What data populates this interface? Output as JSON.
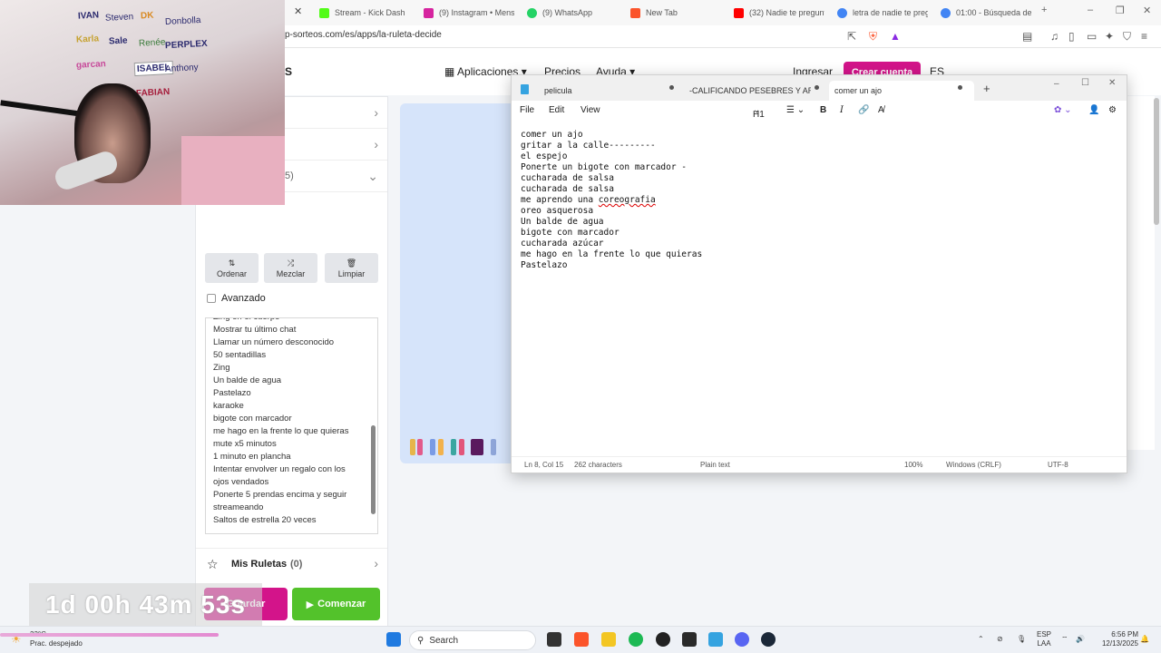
{
  "browser": {
    "tabs": [
      {
        "label": "Stream - Kick Dash",
        "color": "#53fc18"
      },
      {
        "label": "(9) Instagram • Mensa",
        "color": "#d6249f"
      },
      {
        "label": "(9) WhatsApp",
        "color": "#25d366"
      },
      {
        "label": "New Tab",
        "color": "#fb542b"
      },
      {
        "label": "(32) Nadie te pregunt",
        "color": "#ff0000"
      },
      {
        "label": "letra de nadie te preg",
        "color": "#4285f4"
      },
      {
        "label": "01:00 - Búsqueda de G",
        "color": "#4285f4"
      }
    ],
    "url": "p-sorteos.com/es/apps/la-ruleta-decide"
  },
  "site": {
    "logo_fragment": "S",
    "nav": {
      "apps": "Aplicaciones",
      "prices": "Precios",
      "help": "Ayuda",
      "login": "Ingresar",
      "signup": "Crear cuenta",
      "lang": "ES"
    }
  },
  "panel": {
    "entry_count_fragment": "5)",
    "tools": {
      "sort": "Ordenar",
      "shuffle": "Mezclar",
      "clear": "Limpiar"
    },
    "advanced_label": "Avanzado",
    "entries": [
      "Zing en el cuerpo",
      "Mostrar tu último chat",
      "Llamar un número desconocido",
      "50 sentadillas",
      "Zing",
      "Un balde de agua",
      "Pastelazo",
      "karaoke",
      "bigote con marcador",
      "me hago en la frente lo que quieras",
      "mute x5 minutos",
      "1 minuto en plancha",
      "Intentar envolver un regalo con los ojos vendados",
      "Ponerte 5 prendas encima y seguir streameando",
      "Saltos de estrella 20 veces"
    ],
    "my_wheels_label": "Mis Ruletas",
    "my_wheels_count": "(0)",
    "save_label": "Guardar",
    "start_label": "Comenzar"
  },
  "notepad": {
    "tabs": [
      "pelicula",
      "-CALIFICANDO PESEBRES Y ARBOLE",
      "comer un ajo"
    ],
    "menu": [
      "File",
      "Edit",
      "View"
    ],
    "heading_control": "H1",
    "lines": [
      "comer un ajo",
      "gritar a la calle---------",
      "el espejo",
      "Ponerte un bigote con marcador -",
      "cucharada de salsa",
      "cucharada de salsa",
      "me aprendo una ",
      "oreo asquerosa",
      "Un balde de agua",
      "bigote con marcador",
      "cucharada azúcar",
      "me hago en la frente lo que quieras",
      "Pastelazo"
    ],
    "misspelled_word": "coreografia",
    "status": {
      "position": "Ln 8, Col 15",
      "chars": "262 characters",
      "format": "Plain text",
      "zoom": "100%",
      "line_ending": "Windows (CRLF)",
      "encoding": "UTF-8"
    }
  },
  "stream_overlay": {
    "wall_names": [
      "IVAN",
      "Steven",
      "DK",
      "Donbolla",
      "Karla",
      "Sale",
      "Renée",
      "PERPLEX",
      "garcan",
      "ISABEL",
      "Anthony",
      "FABIAN"
    ],
    "timer": "1d 00h 43m 53s"
  },
  "taskbar": {
    "weather_temp": "23°C",
    "weather_desc": "Prac. despejado",
    "search": "Search",
    "lang_top": "ESP",
    "lang_bottom": "LAA",
    "time": "6:56 PM",
    "date": "12/13/2025"
  }
}
